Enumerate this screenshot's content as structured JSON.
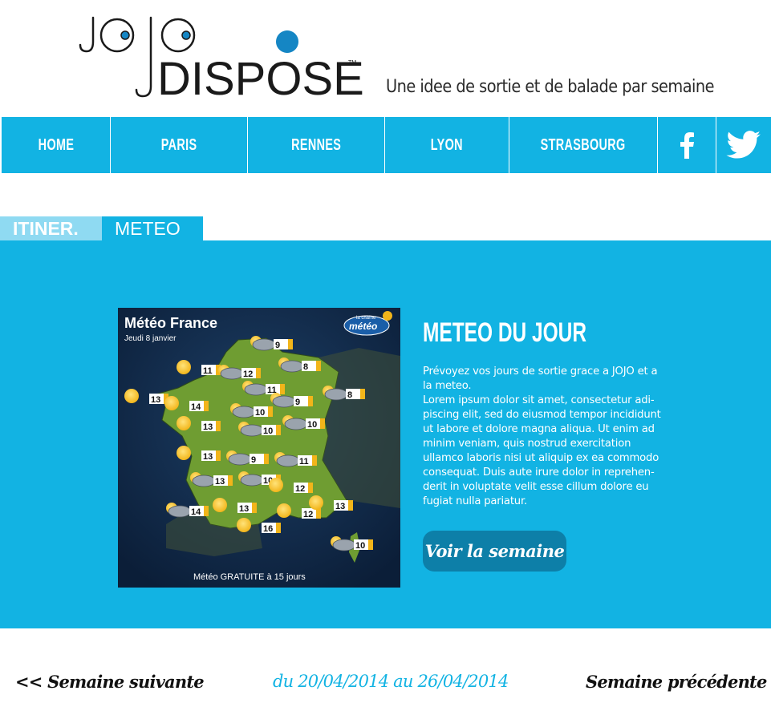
{
  "brand": {
    "logo_top": "JOJO",
    "logo_bottom": "DISPOSE",
    "trademark": "TM",
    "tagline": "Une idee de sortie et de balade par semaine",
    "accent": "#12b3e3",
    "logo_dark": "#1a1a1a",
    "logo_blue": "#1586c4"
  },
  "nav": {
    "items": [
      {
        "label": "HOME"
      },
      {
        "label": "PARIS"
      },
      {
        "label": "RENNES"
      },
      {
        "label": "LYON"
      },
      {
        "label": "STRASBOURG"
      }
    ],
    "social": [
      "facebook-icon",
      "twitter-icon"
    ]
  },
  "tabs": [
    {
      "label": "ITINER."
    },
    {
      "label": "METEO"
    }
  ],
  "map": {
    "title": "Météo France",
    "date": "Jeudi 8 janvier",
    "channel_small": "la chaîne",
    "channel": "météo",
    "footer": "Météo GRATUITE à 15 jours",
    "temps": [
      "9",
      "11",
      "12",
      "8",
      "11",
      "13",
      "9",
      "8",
      "14",
      "10",
      "13",
      "10",
      "10",
      "13",
      "9",
      "11",
      "13",
      "10",
      "12",
      "14",
      "13",
      "12",
      "13",
      "16",
      "10"
    ]
  },
  "section": {
    "title": "METEO DU JOUR",
    "paragraph1": "Prévoyez vos jours de sortie grace a JOJO et a la meteo.",
    "paragraph2": "Lorem ipsum dolor sit amet, consectetur adi-piscing elit, sed do eiusmod tempor incididunt ut labore et dolore magna aliqua. Ut enim ad minim veniam, quis nostrud exercitation ullamco laboris nisi ut aliquip ex ea commodo consequat. Duis aute irure dolor in reprehen-derit in voluptate velit esse cillum dolore eu fugiat nulla pariatur.",
    "button": "Voir la semaine"
  },
  "footer": {
    "prev": "<< Semaine suivante",
    "range": "du 20/04/2014 au 26/04/2014",
    "next": "Semaine précédente >>"
  }
}
